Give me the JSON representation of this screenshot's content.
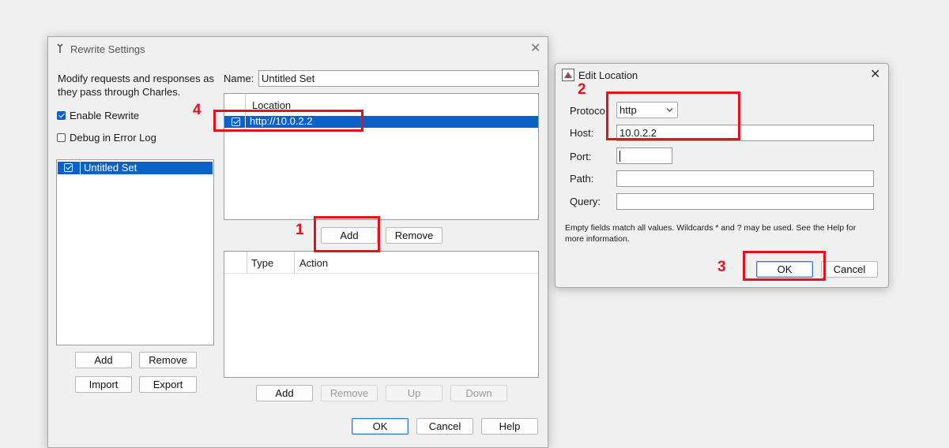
{
  "rewrite": {
    "title": "Rewrite Settings",
    "description": "Modify requests and responses as they pass through Charles.",
    "enable_rewrite": "Enable Rewrite",
    "debug_log": "Debug in Error Log",
    "sets": [
      "Untitled Set"
    ],
    "sets_add": "Add",
    "sets_remove": "Remove",
    "sets_import": "Import",
    "sets_export": "Export",
    "name_label": "Name:",
    "name_value": "Untitled Set",
    "location_header": "Location",
    "locations": [
      "http://10.0.2.2"
    ],
    "loc_add": "Add",
    "loc_remove": "Remove",
    "rules_type_header": "Type",
    "rules_action_header": "Action",
    "rule_add": "Add",
    "rule_remove": "Remove",
    "rule_up": "Up",
    "rule_down": "Down",
    "ok": "OK",
    "cancel": "Cancel",
    "help": "Help"
  },
  "edit": {
    "title": "Edit Location",
    "protocol_label": "Protoco",
    "protocol_value": "http",
    "host_label": "Host:",
    "host_value": "10.0.2.2",
    "port_label": "Port:",
    "port_value": "",
    "path_label": "Path:",
    "path_value": "",
    "query_label": "Query:",
    "query_value": "",
    "help_text": "Empty fields match all values. Wildcards * and ? may be used. See the Help for more information.",
    "ok": "OK",
    "cancel": "Cancel"
  },
  "annotations": [
    "1",
    "2",
    "3",
    "4"
  ],
  "colors": {
    "accent": "#0a62c9",
    "highlight": "#e8101a"
  },
  "icons": {
    "rewrite": "wrench-icon",
    "edit": "java-window-icon",
    "close": "close-icon",
    "dropdown": "chevron-down-icon",
    "check": "check-icon"
  }
}
